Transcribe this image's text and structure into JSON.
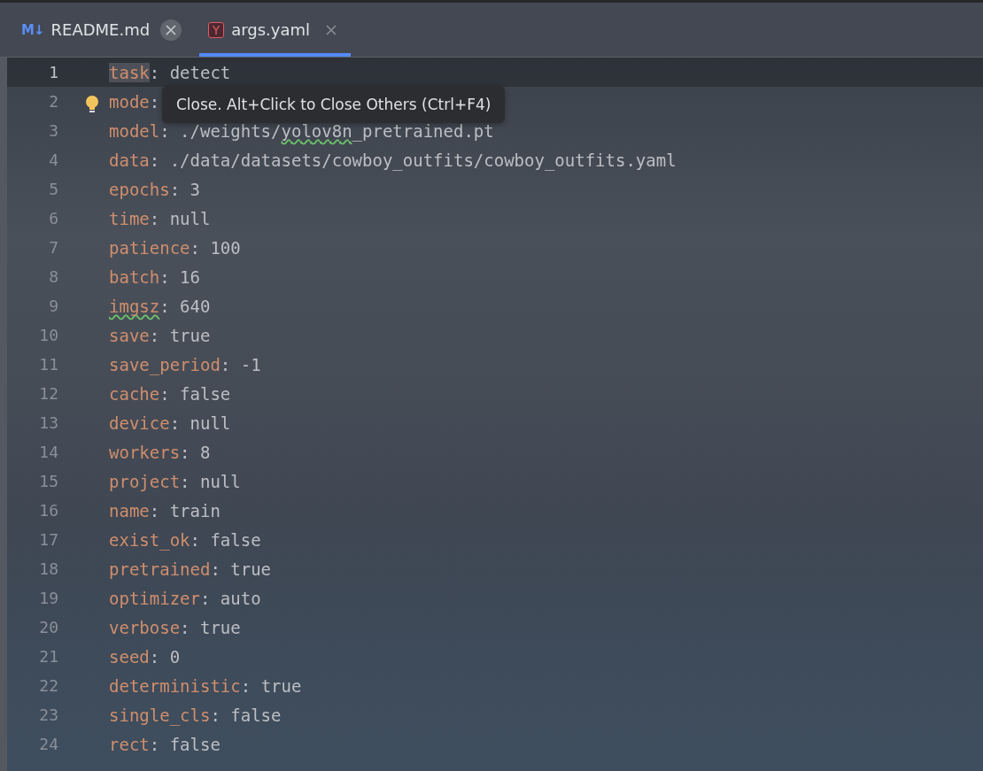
{
  "tabs": [
    {
      "label": "README.md",
      "kind": "markdown",
      "icon_text": "M↓",
      "selected": false,
      "close_hovered": true
    },
    {
      "label": "args.yaml",
      "kind": "yaml",
      "icon_text": "Y",
      "selected": true,
      "close_hovered": false
    }
  ],
  "tooltip": {
    "text": "Close. Alt+Click to Close Others (Ctrl+F4)"
  },
  "editor": {
    "lines": [
      {
        "number": "1",
        "current": true,
        "key": "task",
        "colon": ":",
        "key_typo": false,
        "value": [
          {
            "text": "detect",
            "typo": false
          }
        ]
      },
      {
        "number": "2",
        "current": false,
        "key": "mode",
        "colon": ":",
        "key_typo": false
      },
      {
        "number": "3",
        "current": false,
        "key": "model",
        "colon": ":",
        "key_typo": false,
        "value": [
          {
            "text": "./weights/",
            "typo": false
          },
          {
            "text": "yolov8n",
            "typo": true
          },
          {
            "text": "_pretrained.pt",
            "typo": false
          }
        ]
      },
      {
        "number": "4",
        "current": false,
        "key": "data",
        "colon": ":",
        "key_typo": false,
        "value": [
          {
            "text": "./data/datasets/cowboy_outfits/cowboy_outfits.yaml",
            "typo": false
          }
        ]
      },
      {
        "number": "5",
        "current": false,
        "key": "epochs",
        "colon": ":",
        "key_typo": false,
        "value": [
          {
            "text": "3",
            "typo": false
          }
        ]
      },
      {
        "number": "6",
        "current": false,
        "key": "time",
        "colon": ":",
        "key_typo": false,
        "value": [
          {
            "text": "null",
            "typo": false
          }
        ]
      },
      {
        "number": "7",
        "current": false,
        "key": "patience",
        "colon": ":",
        "key_typo": false,
        "value": [
          {
            "text": "100",
            "typo": false
          }
        ]
      },
      {
        "number": "8",
        "current": false,
        "key": "batch",
        "colon": ":",
        "key_typo": false,
        "value": [
          {
            "text": "16",
            "typo": false
          }
        ]
      },
      {
        "number": "9",
        "current": false,
        "key": "imgsz",
        "colon": ":",
        "key_typo": true,
        "value": [
          {
            "text": "640",
            "typo": false
          }
        ]
      },
      {
        "number": "10",
        "current": false,
        "key": "save",
        "colon": ":",
        "key_typo": false,
        "value": [
          {
            "text": "true",
            "typo": false
          }
        ]
      },
      {
        "number": "11",
        "current": false,
        "key": "save_period",
        "colon": ":",
        "key_typo": false,
        "value": [
          {
            "text": "-1",
            "typo": false
          }
        ]
      },
      {
        "number": "12",
        "current": false,
        "key": "cache",
        "colon": ":",
        "key_typo": false,
        "value": [
          {
            "text": "false",
            "typo": false
          }
        ]
      },
      {
        "number": "13",
        "current": false,
        "key": "device",
        "colon": ":",
        "key_typo": false,
        "value": [
          {
            "text": "null",
            "typo": false
          }
        ]
      },
      {
        "number": "14",
        "current": false,
        "key": "workers",
        "colon": ":",
        "key_typo": false,
        "value": [
          {
            "text": "8",
            "typo": false
          }
        ]
      },
      {
        "number": "15",
        "current": false,
        "key": "project",
        "colon": ":",
        "key_typo": false,
        "value": [
          {
            "text": "null",
            "typo": false
          }
        ]
      },
      {
        "number": "16",
        "current": false,
        "key": "name",
        "colon": ":",
        "key_typo": false,
        "value": [
          {
            "text": "train",
            "typo": false
          }
        ]
      },
      {
        "number": "17",
        "current": false,
        "key": "exist_ok",
        "colon": ":",
        "key_typo": false,
        "value": [
          {
            "text": "false",
            "typo": false
          }
        ]
      },
      {
        "number": "18",
        "current": false,
        "key": "pretrained",
        "colon": ":",
        "key_typo": false,
        "value": [
          {
            "text": "true",
            "typo": false
          }
        ]
      },
      {
        "number": "19",
        "current": false,
        "key": "optimizer",
        "colon": ":",
        "key_typo": false,
        "value": [
          {
            "text": "auto",
            "typo": false
          }
        ]
      },
      {
        "number": "20",
        "current": false,
        "key": "verbose",
        "colon": ":",
        "key_typo": false,
        "value": [
          {
            "text": "true",
            "typo": false
          }
        ]
      },
      {
        "number": "21",
        "current": false,
        "key": "seed",
        "colon": ":",
        "key_typo": false,
        "value": [
          {
            "text": "0",
            "typo": false
          }
        ]
      },
      {
        "number": "22",
        "current": false,
        "key": "deterministic",
        "colon": ":",
        "key_typo": false,
        "value": [
          {
            "text": "true",
            "typo": false
          }
        ]
      },
      {
        "number": "23",
        "current": false,
        "key": "single_cls",
        "colon": ":",
        "key_typo": false,
        "value": [
          {
            "text": "false",
            "typo": false
          }
        ]
      },
      {
        "number": "24",
        "current": false,
        "key": "rect",
        "colon": ":",
        "key_typo": false,
        "value": [
          {
            "text": "false",
            "typo": false
          }
        ]
      }
    ]
  }
}
